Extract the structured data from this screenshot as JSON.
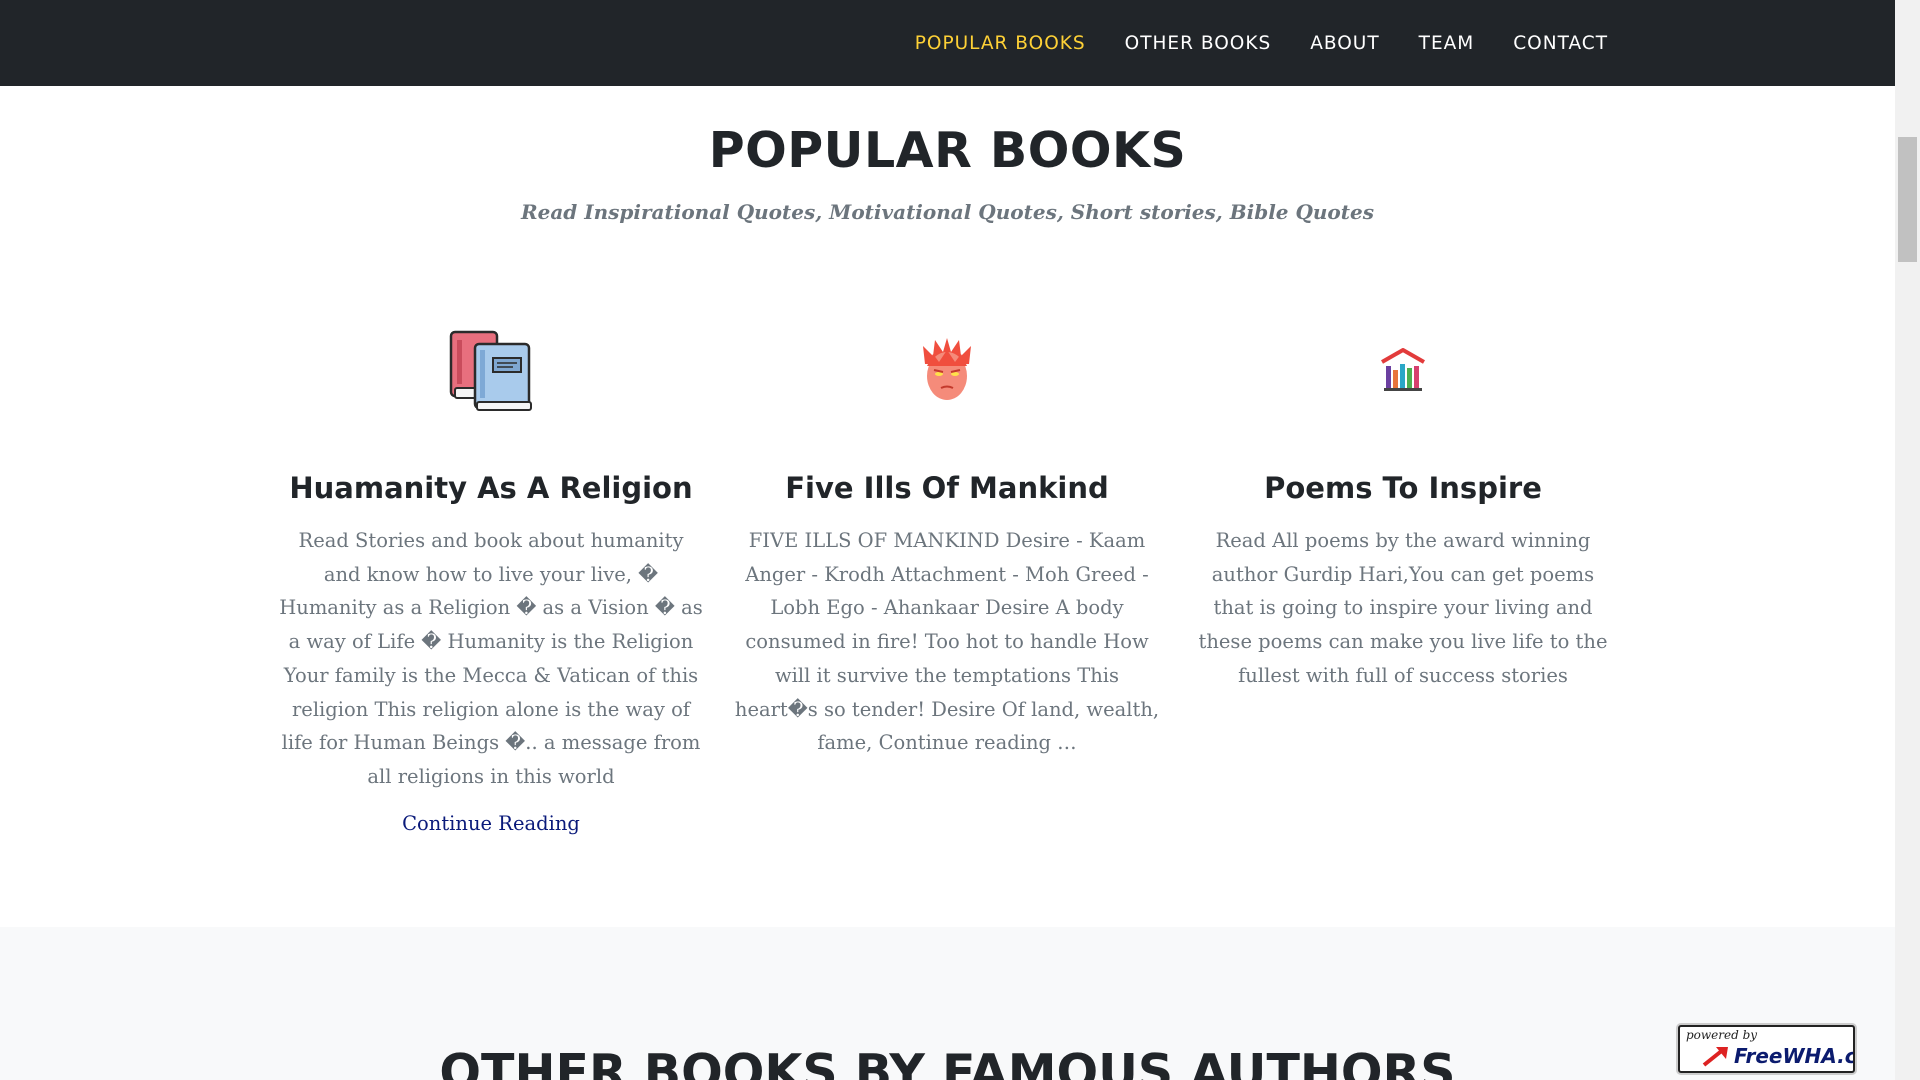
{
  "navbar": {
    "links": [
      {
        "label": "POPULAR BOOKS",
        "active": true
      },
      {
        "label": "OTHER BOOKS",
        "active": false
      },
      {
        "label": "ABOUT",
        "active": false
      },
      {
        "label": "TEAM",
        "active": false
      },
      {
        "label": "CONTACT",
        "active": false
      }
    ]
  },
  "popular": {
    "heading": "POPULAR BOOKS",
    "subheading": "Read Inspirational Quotes, Motivational Quotes, Short stories, Bible Quotes",
    "books": [
      {
        "icon": "books-icon",
        "title": "Huamanity As A Religion",
        "text": "Read Stories and book about humanity and know how to live your live, � Humanity as a Religion � as a Vision � as a way of Life � Humanity is the Religion Your family is the Mecca & Vatican of this religion This religion alone is the way of life for Human Beings �.. a message from all religions in this world",
        "link": "Continue Reading"
      },
      {
        "icon": "angry-face-icon",
        "title": "Five Ills Of Mankind",
        "text": "FIVE ILLS OF MANKIND Desire - Kaam Anger - Krodh Attachment - Moh Greed - Lobh Ego - Ahankaar Desire A body consumed in fire! Too hot to handle How will it survive the temptations This heart�s so tender! Desire Of land, wealth, fame, Continue reading …"
      },
      {
        "icon": "library-icon",
        "title": "Poems To Inspire",
        "text": "Read All poems by the award winning author Gurdip Hari,You can get poems that is going to inspire your living and these poems can make you live life to the fullest with full of success stories"
      }
    ]
  },
  "other": {
    "heading": "OTHER BOOKS BY FAMOUS AUTHORS"
  },
  "badge": {
    "small": "powered by",
    "big": "FreeWHA.com"
  },
  "colors": {
    "navbar_bg": "#212529",
    "accent": "#fed136",
    "link": "#0a1a7a",
    "muted_text": "#6c757d"
  }
}
